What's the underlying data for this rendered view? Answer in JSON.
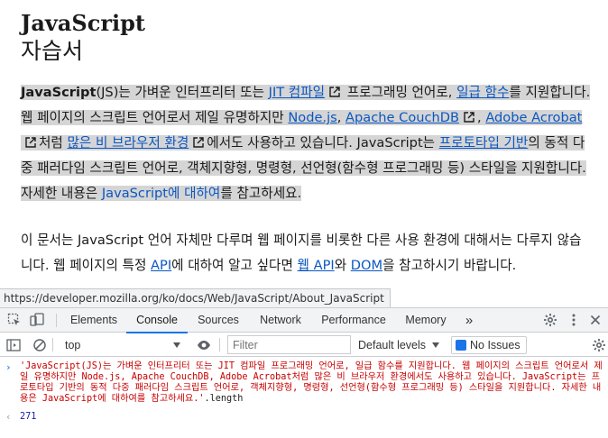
{
  "page": {
    "title_line1": "JavaScript",
    "title_line2": "자습서",
    "para1": {
      "bold_term": "JavaScript",
      "t1": "(JS)는 가벼운 인터프리터 또는 ",
      "link_jit": "JIT 컴파일",
      "t2": " 프로그래밍 언어로, ",
      "link_first_class": "일급 함수",
      "t3": "를 지원합니다. 웹 페이지의 스크립트 언어로서 제일 유명하지만 ",
      "link_nodejs": "Node.js",
      "t4": ", ",
      "link_couchdb": "Apache CouchDB",
      "t5": ", ",
      "link_acrobat": "Adobe Acrobat",
      "t6": "처럼 ",
      "link_browsers": "많은 비 브라우저 환경",
      "t7": "에서도 사용하고 있습니다. JavaScript는 ",
      "link_prototype": "프로토타입 기반",
      "t8": "의 동적 다중 패러다임 스크립트 언어로, 객체지향형, 명령형, 선언형(함수형 프로그래밍 등) 스타일을 지원합니다. 자세한 내용은 ",
      "link_about": "JavaScript에 대하여",
      "t9": "를 참고하세요."
    },
    "para2": {
      "t1": "이 문서는 JavaScript 언어 자체만 다루며 웹 페이지를 비롯한 다른 사용 환경에 대해서는 다루지 않습니다. 웹 페이지의 특정 ",
      "link_api": "API",
      "t2": "에 대하여 알고 싶다면 ",
      "link_web_api": "웹 API",
      "t3": "와 ",
      "link_dom": "DOM",
      "t4": "을 참고하시기 바랍니다."
    },
    "status_url": "https://developer.mozilla.org/ko/docs/Web/JavaScript/About_JavaScript"
  },
  "devtools": {
    "tabs": [
      "Elements",
      "Console",
      "Sources",
      "Network",
      "Performance",
      "Memory"
    ],
    "active_tab": "Console",
    "more_tabs": "»",
    "context": "top",
    "filter_placeholder": "Filter",
    "levels_label": "Default levels",
    "issues_label": "No Issues",
    "console_input": "'JavaScript(JS)는 가벼운 인터프리터 또는 JIT 컴파일 프로그래밍 언어로, 일급 함수를 지원합니다. 웹 페이지의 스크립트 언어로서 제일 유명하지만 Node.js, Apache CouchDB, Adobe Acrobat처럼 많은 비 브라우저 환경에서도 사용하고 있습니다. JavaScript는 프로토타입 기반의 동적 다중 패러다임 스크립트 언어로, 객체지향형, 명령형, 선언형(함수형 프로그래밍 등) 스타일을 지원합니다. 자세한 내용은 JavaScript에 대하여를 참고하세요.'",
    "console_input_suffix": ".length",
    "console_result": "271"
  },
  "colors": {
    "link": "#0b57c2",
    "selection_highlight": "#d5d5d5",
    "devtools_accent": "#1a73e8",
    "console_string": "#c80000",
    "console_number": "#1a1aa6"
  }
}
